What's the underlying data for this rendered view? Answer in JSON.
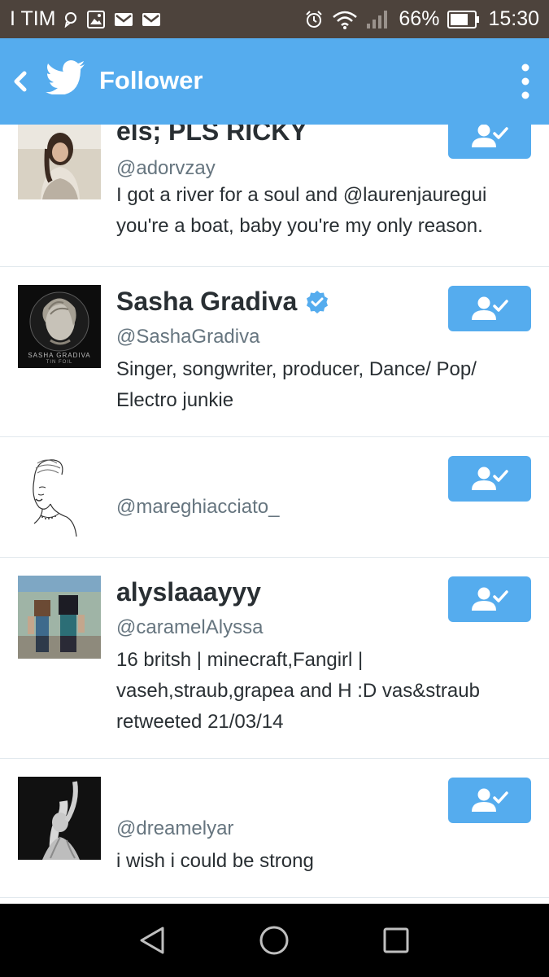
{
  "status_bar": {
    "carrier": "I TIM",
    "battery": "66%",
    "time": "15:30"
  },
  "app_bar": {
    "title": "Follower"
  },
  "followers": [
    {
      "name": "els; PLS RICKY",
      "handle": "@adorvzay",
      "bio": "I got a river for a soul and @laurenjauregui you're a boat, baby you're my only reason.",
      "verified": false
    },
    {
      "name": "Sasha Gradiva",
      "handle": "@SashaGradiva",
      "bio": "Singer, songwriter, producer, Dance/ Pop/ Electro junkie",
      "verified": true,
      "avatar_text": "SASHA GRADIVA",
      "avatar_subtext": "TIN FOIL"
    },
    {
      "name": "",
      "handle": "@mareghiacciato_",
      "bio": "",
      "verified": false
    },
    {
      "name": "alyslaaayyy",
      "handle": "@caramelAlyssa",
      "bio": "16 britsh | minecraft,Fangirl | vaseh,straub,grapea and H :D vas&straub retweeted 21/03/14",
      "verified": false
    },
    {
      "name": "",
      "handle": "@dreamelyar",
      "bio": "i wish i could be strong",
      "verified": false
    }
  ],
  "colors": {
    "brand": "#55acee",
    "status_bar": "#4d433c",
    "nav_bar": "#000000",
    "verified": "#55acee"
  }
}
